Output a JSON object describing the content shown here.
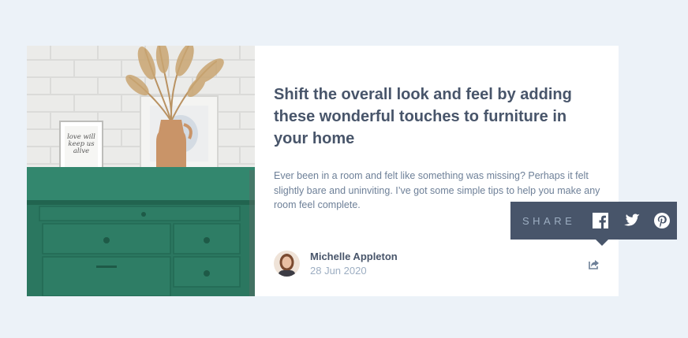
{
  "article": {
    "title": "Shift the overall look and feel by adding these wonderful touches to furniture in your home",
    "excerpt": "Ever been in a room and felt like something was missing? Perhaps it felt slightly bare and uninviting. I’ve got some simple tips to help you make any room feel complete.",
    "frame_text": "love will keep us alive"
  },
  "author": {
    "name": "Michelle Appleton",
    "date": "28 Jun 2020"
  },
  "share": {
    "label": "SHARE",
    "icons": [
      "facebook-icon",
      "twitter-icon",
      "pinterest-icon",
      "share-icon"
    ]
  },
  "colors": {
    "background": "#ECF2F8",
    "card": "#FFFFFF",
    "title": "#48556A",
    "text": "#6E8098",
    "muted": "#9DAEC2",
    "popup": "#48556A",
    "drawers": "#2E7A63"
  }
}
